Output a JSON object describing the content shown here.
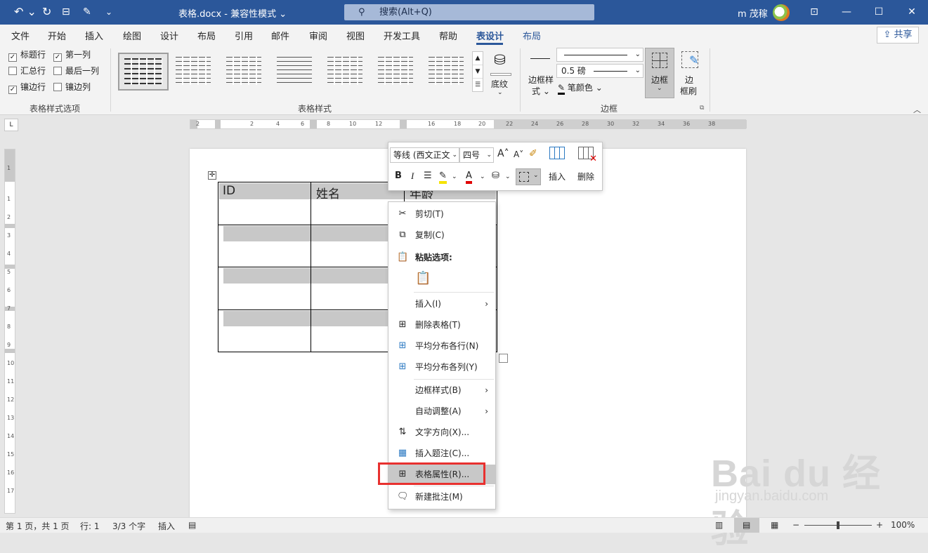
{
  "titlebar": {
    "title": "表格.docx  -  兼容性模式 ⌄",
    "search_placeholder": "搜索(Alt+Q)",
    "user": "m 茂稼",
    "qa_undo": "↶ ⌄",
    "qa_redo": "↻",
    "qa_more": "⌄",
    "minimize": "—",
    "restore": "☐",
    "close": "✕",
    "ribbon_display": "⊡"
  },
  "tabs": [
    "文件",
    "开始",
    "插入",
    "绘图",
    "设计",
    "布局",
    "引用",
    "邮件",
    "审阅",
    "视图",
    "开发工具",
    "帮助",
    "表设计",
    "布局"
  ],
  "active_tab_index": 12,
  "share_label": "共享",
  "ribbon": {
    "style_options": {
      "label": "表格样式选项",
      "options": [
        {
          "label": "标题行",
          "checked": true
        },
        {
          "label": "第一列",
          "checked": true
        },
        {
          "label": "汇总行",
          "checked": false
        },
        {
          "label": "最后一列",
          "checked": false
        },
        {
          "label": "镶边行",
          "checked": true
        },
        {
          "label": "镶边列",
          "checked": false
        }
      ]
    },
    "table_styles": {
      "label": "表格样式",
      "shading": "底纹"
    },
    "borders": {
      "label": "边框",
      "border_styles": "边框样",
      "border_styles_2": "式 ⌄",
      "line_weight": "0.5 磅",
      "pen_color": "笔颜色 ⌄",
      "borders_btn": "边框",
      "border_painter": "边",
      "border_painter_2": "框刷"
    }
  },
  "ruler": {
    "h_numbers": [
      "2",
      "2",
      "4",
      "6",
      "8",
      "10",
      "12",
      "16",
      "18",
      "20",
      "22",
      "24",
      "26",
      "28",
      "30",
      "32",
      "34",
      "36",
      "38"
    ],
    "v_numbers": [
      "1",
      "1",
      "2",
      "3",
      "4",
      "5",
      "6",
      "7",
      "8",
      "9",
      "10",
      "11",
      "12",
      "13",
      "14",
      "15",
      "16",
      "17"
    ]
  },
  "table": {
    "headers": [
      "ID",
      "姓名",
      "年龄"
    ]
  },
  "mini_toolbar": {
    "font": "等线 (西文正文",
    "size": "四号",
    "grow": "A˄",
    "shrink": "A˅",
    "bold": "B",
    "italic": "I",
    "insert": "插入",
    "delete": "删除"
  },
  "context_menu": [
    {
      "label": "剪切(T)",
      "icon": "scissors-icon"
    },
    {
      "label": "复制(C)",
      "icon": "copy-icon"
    },
    {
      "label": "粘贴选项:",
      "icon": "paste-icon"
    },
    {
      "label": "插入(I)",
      "icon": "",
      "submenu": true
    },
    {
      "label": "删除表格(T)",
      "icon": "delete-table-icon"
    },
    {
      "label": "平均分布各行(N)",
      "icon": "distribute-rows-icon"
    },
    {
      "label": "平均分布各列(Y)",
      "icon": "distribute-columns-icon"
    },
    {
      "label": "边框样式(B)",
      "icon": "",
      "submenu": true
    },
    {
      "label": "自动调整(A)",
      "icon": "",
      "submenu": true
    },
    {
      "label": "文字方向(X)...",
      "icon": "text-direction-icon"
    },
    {
      "label": "插入题注(C)...",
      "icon": "caption-icon"
    },
    {
      "label": "表格属性(R)...",
      "icon": "table-properties-icon"
    },
    {
      "label": "新建批注(M)",
      "icon": "comment-icon"
    }
  ],
  "statusbar": {
    "page": "第 1 页，共 1 页",
    "line": "行: 1",
    "words": "3/3 个字",
    "mode": "插入",
    "zoom_minus": "−",
    "zoom_plus": "+",
    "zoom": "100%"
  },
  "watermark": {
    "logo": "Bai du 经验",
    "url": "jingyan.baidu.com"
  },
  "colors": {
    "titlebar": "#2b579a",
    "highlight": "#e8312f",
    "shade": "#c8c8c8"
  }
}
